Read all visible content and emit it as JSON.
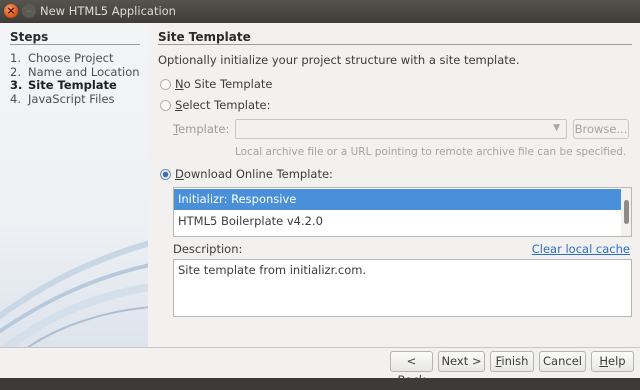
{
  "window": {
    "title": "New HTML5 Application",
    "close_glyph": "×",
    "minimize_glyph": "–"
  },
  "steps": {
    "title": "Steps",
    "items": [
      {
        "num": "1.",
        "label": "Choose Project"
      },
      {
        "num": "2.",
        "label": "Name and Location"
      },
      {
        "num": "3.",
        "label": "Site Template",
        "current": true
      },
      {
        "num": "4.",
        "label": "JavaScript Files"
      }
    ]
  },
  "content": {
    "title": "Site Template",
    "description": "Optionally initialize your project structure with a site template.",
    "options": {
      "no_template": {
        "mnemonic": "N",
        "rest": "o Site Template",
        "checked": false
      },
      "select_template": {
        "mnemonic": "S",
        "rest": "elect Template:",
        "checked": false
      },
      "download_template": {
        "mnemonic": "D",
        "rest": "ownload Online Template:",
        "checked": true
      }
    },
    "template_field": {
      "label_mnemonic": "T",
      "label_rest": "emplate:",
      "value": "",
      "arrow_icon": "chevron-down-icon",
      "browse_label": "Browse...",
      "hint": "Local archive file or a URL pointing to remote archive file can be specified."
    },
    "online_templates": [
      {
        "label": "Initializr: Responsive",
        "selected": true
      },
      {
        "label": "HTML5 Boilerplate v4.2.0",
        "selected": false
      }
    ],
    "description_label": "Description:",
    "clear_cache_link": "Clear local cache",
    "description_text": "Site template from initializr.com."
  },
  "footer": {
    "back": {
      "pre": "< ",
      "mnemonic": "B",
      "post": "ack"
    },
    "next": "Next >",
    "finish": {
      "mnemonic": "F",
      "post": "inish"
    },
    "cancel": "Cancel",
    "help": {
      "mnemonic": "H",
      "post": "elp"
    }
  },
  "colors": {
    "accent": "#4a90d9",
    "link": "#2a6fc9",
    "titlebar": "#3d3c38",
    "close_button": "#e1571c"
  }
}
